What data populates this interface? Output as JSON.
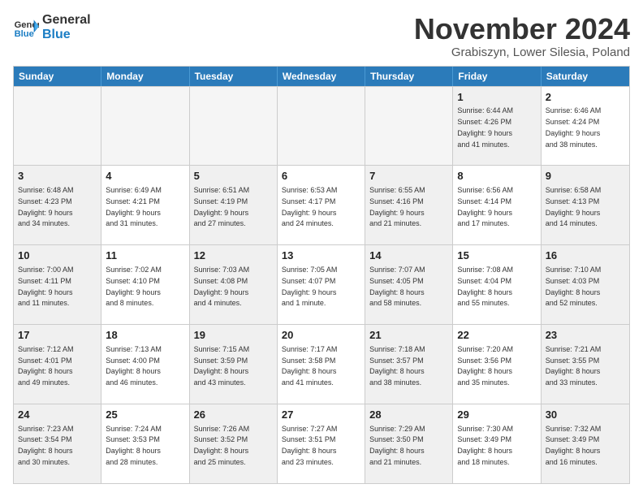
{
  "logo": {
    "line1": "General",
    "line2": "Blue"
  },
  "title": "November 2024",
  "subtitle": "Grabiszyn, Lower Silesia, Poland",
  "header_days": [
    "Sunday",
    "Monday",
    "Tuesday",
    "Wednesday",
    "Thursday",
    "Friday",
    "Saturday"
  ],
  "rows": [
    [
      {
        "day": "",
        "text": "",
        "empty": true
      },
      {
        "day": "",
        "text": "",
        "empty": true
      },
      {
        "day": "",
        "text": "",
        "empty": true
      },
      {
        "day": "",
        "text": "",
        "empty": true
      },
      {
        "day": "",
        "text": "",
        "empty": true
      },
      {
        "day": "1",
        "text": "Sunrise: 6:44 AM\nSunset: 4:26 PM\nDaylight: 9 hours\nand 41 minutes.",
        "shaded": true
      },
      {
        "day": "2",
        "text": "Sunrise: 6:46 AM\nSunset: 4:24 PM\nDaylight: 9 hours\nand 38 minutes.",
        "shaded": false
      }
    ],
    [
      {
        "day": "3",
        "text": "Sunrise: 6:48 AM\nSunset: 4:23 PM\nDaylight: 9 hours\nand 34 minutes.",
        "shaded": true
      },
      {
        "day": "4",
        "text": "Sunrise: 6:49 AM\nSunset: 4:21 PM\nDaylight: 9 hours\nand 31 minutes.",
        "shaded": false
      },
      {
        "day": "5",
        "text": "Sunrise: 6:51 AM\nSunset: 4:19 PM\nDaylight: 9 hours\nand 27 minutes.",
        "shaded": true
      },
      {
        "day": "6",
        "text": "Sunrise: 6:53 AM\nSunset: 4:17 PM\nDaylight: 9 hours\nand 24 minutes.",
        "shaded": false
      },
      {
        "day": "7",
        "text": "Sunrise: 6:55 AM\nSunset: 4:16 PM\nDaylight: 9 hours\nand 21 minutes.",
        "shaded": true
      },
      {
        "day": "8",
        "text": "Sunrise: 6:56 AM\nSunset: 4:14 PM\nDaylight: 9 hours\nand 17 minutes.",
        "shaded": false
      },
      {
        "day": "9",
        "text": "Sunrise: 6:58 AM\nSunset: 4:13 PM\nDaylight: 9 hours\nand 14 minutes.",
        "shaded": true
      }
    ],
    [
      {
        "day": "10",
        "text": "Sunrise: 7:00 AM\nSunset: 4:11 PM\nDaylight: 9 hours\nand 11 minutes.",
        "shaded": true
      },
      {
        "day": "11",
        "text": "Sunrise: 7:02 AM\nSunset: 4:10 PM\nDaylight: 9 hours\nand 8 minutes.",
        "shaded": false
      },
      {
        "day": "12",
        "text": "Sunrise: 7:03 AM\nSunset: 4:08 PM\nDaylight: 9 hours\nand 4 minutes.",
        "shaded": true
      },
      {
        "day": "13",
        "text": "Sunrise: 7:05 AM\nSunset: 4:07 PM\nDaylight: 9 hours\nand 1 minute.",
        "shaded": false
      },
      {
        "day": "14",
        "text": "Sunrise: 7:07 AM\nSunset: 4:05 PM\nDaylight: 8 hours\nand 58 minutes.",
        "shaded": true
      },
      {
        "day": "15",
        "text": "Sunrise: 7:08 AM\nSunset: 4:04 PM\nDaylight: 8 hours\nand 55 minutes.",
        "shaded": false
      },
      {
        "day": "16",
        "text": "Sunrise: 7:10 AM\nSunset: 4:03 PM\nDaylight: 8 hours\nand 52 minutes.",
        "shaded": true
      }
    ],
    [
      {
        "day": "17",
        "text": "Sunrise: 7:12 AM\nSunset: 4:01 PM\nDaylight: 8 hours\nand 49 minutes.",
        "shaded": true
      },
      {
        "day": "18",
        "text": "Sunrise: 7:13 AM\nSunset: 4:00 PM\nDaylight: 8 hours\nand 46 minutes.",
        "shaded": false
      },
      {
        "day": "19",
        "text": "Sunrise: 7:15 AM\nSunset: 3:59 PM\nDaylight: 8 hours\nand 43 minutes.",
        "shaded": true
      },
      {
        "day": "20",
        "text": "Sunrise: 7:17 AM\nSunset: 3:58 PM\nDaylight: 8 hours\nand 41 minutes.",
        "shaded": false
      },
      {
        "day": "21",
        "text": "Sunrise: 7:18 AM\nSunset: 3:57 PM\nDaylight: 8 hours\nand 38 minutes.",
        "shaded": true
      },
      {
        "day": "22",
        "text": "Sunrise: 7:20 AM\nSunset: 3:56 PM\nDaylight: 8 hours\nand 35 minutes.",
        "shaded": false
      },
      {
        "day": "23",
        "text": "Sunrise: 7:21 AM\nSunset: 3:55 PM\nDaylight: 8 hours\nand 33 minutes.",
        "shaded": true
      }
    ],
    [
      {
        "day": "24",
        "text": "Sunrise: 7:23 AM\nSunset: 3:54 PM\nDaylight: 8 hours\nand 30 minutes.",
        "shaded": true
      },
      {
        "day": "25",
        "text": "Sunrise: 7:24 AM\nSunset: 3:53 PM\nDaylight: 8 hours\nand 28 minutes.",
        "shaded": false
      },
      {
        "day": "26",
        "text": "Sunrise: 7:26 AM\nSunset: 3:52 PM\nDaylight: 8 hours\nand 25 minutes.",
        "shaded": true
      },
      {
        "day": "27",
        "text": "Sunrise: 7:27 AM\nSunset: 3:51 PM\nDaylight: 8 hours\nand 23 minutes.",
        "shaded": false
      },
      {
        "day": "28",
        "text": "Sunrise: 7:29 AM\nSunset: 3:50 PM\nDaylight: 8 hours\nand 21 minutes.",
        "shaded": true
      },
      {
        "day": "29",
        "text": "Sunrise: 7:30 AM\nSunset: 3:49 PM\nDaylight: 8 hours\nand 18 minutes.",
        "shaded": false
      },
      {
        "day": "30",
        "text": "Sunrise: 7:32 AM\nSunset: 3:49 PM\nDaylight: 8 hours\nand 16 minutes.",
        "shaded": true
      }
    ]
  ]
}
